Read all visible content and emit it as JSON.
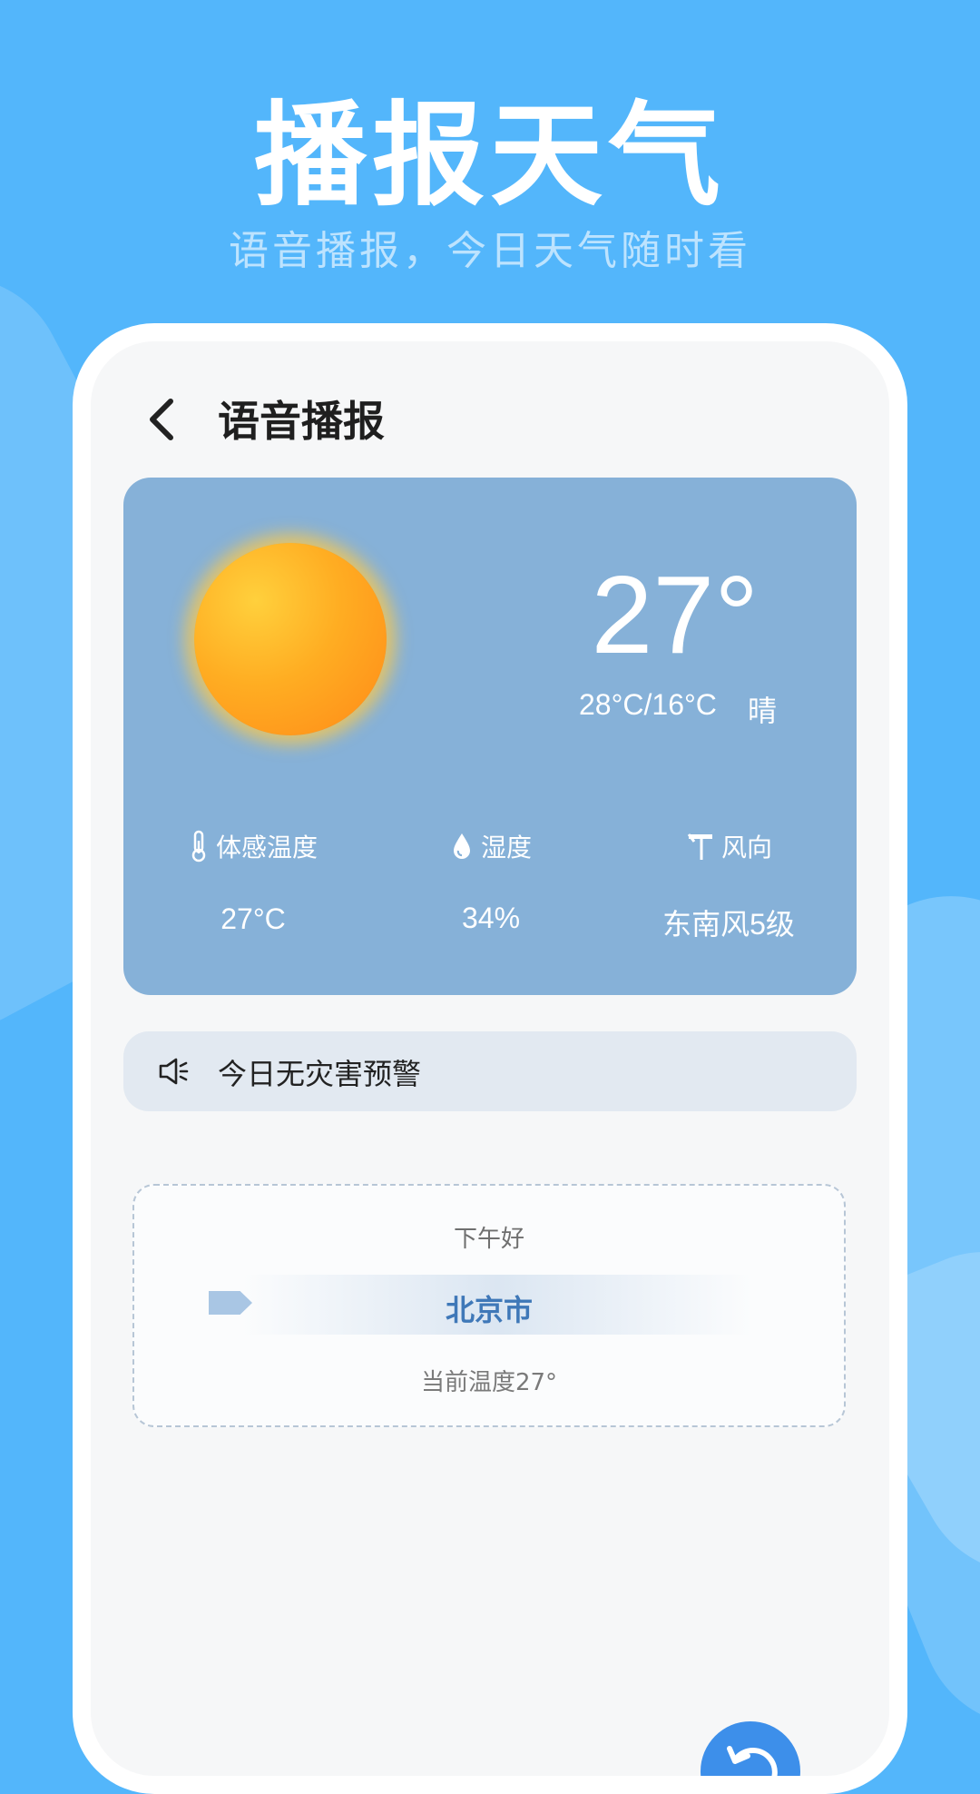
{
  "hero": {
    "title": "播报天气",
    "subtitle": "语音播报，今日天气随时看"
  },
  "screen": {
    "title": "语音播报",
    "back_icon": "chevron-left-icon"
  },
  "weather": {
    "icon": "sun-icon",
    "temperature": "27°",
    "range": "28°C/16°C",
    "condition": "晴",
    "metrics": [
      {
        "icon": "thermometer-icon",
        "label": "体感温度",
        "value": "27°C"
      },
      {
        "icon": "droplet-icon",
        "label": "湿度",
        "value": "34%"
      },
      {
        "icon": "wind-vane-icon",
        "label": "风向",
        "value": "东南风5级"
      }
    ]
  },
  "alert": {
    "icon": "speaker-icon",
    "text": "今日无灾害预警"
  },
  "broadcast": {
    "greeting": "下午好",
    "city": "北京市",
    "current_temp": "当前温度27°"
  },
  "colors": {
    "background": "#53b6fb",
    "card": "#86b1d8",
    "accent": "#3f78b8"
  }
}
